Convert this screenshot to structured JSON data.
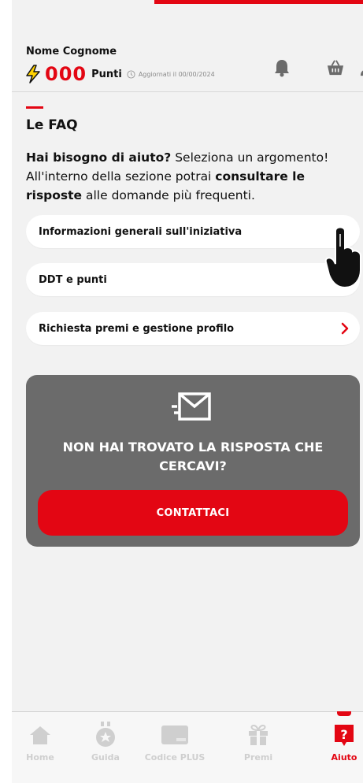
{
  "header": {
    "user_name": "Nome Cognome",
    "points_value": "000",
    "points_label": "Punti",
    "updated_text": "Aggiornati il 00/00/2024",
    "icons": [
      "bell-icon",
      "basket-icon",
      "user-icon"
    ]
  },
  "faq": {
    "title": "Le FAQ",
    "intro_bold_1": "Hai bisogno di aiuto?",
    "intro_text_1": " Seleziona un argomento! All'interno della sezione potrai ",
    "intro_bold_2": "consultare le risposte",
    "intro_text_2": " alle domande più frequenti.",
    "items": [
      {
        "label": "Informazioni generali sull'iniziativa"
      },
      {
        "label": "DDT e punti"
      },
      {
        "label": "Richiesta premi e gestione profilo"
      }
    ]
  },
  "contact": {
    "question": "NON HAI TROVATO LA RISPOSTA CHE CERCAVI?",
    "button_label": "CONTATTACI"
  },
  "bottom_nav": {
    "items": [
      {
        "label": "Home",
        "icon": "home-icon"
      },
      {
        "label": "Guida",
        "icon": "medal-icon"
      },
      {
        "label": "Codice PLUS",
        "icon": "card-icon"
      },
      {
        "label": "Premi",
        "icon": "gift-icon"
      },
      {
        "label": "Aiuto",
        "icon": "help-icon",
        "active": true
      }
    ]
  },
  "colors": {
    "accent": "#e30613",
    "background": "#f2f2f2",
    "card_dark": "#6b6b6b",
    "inactive_nav": "#cfcfcf"
  }
}
